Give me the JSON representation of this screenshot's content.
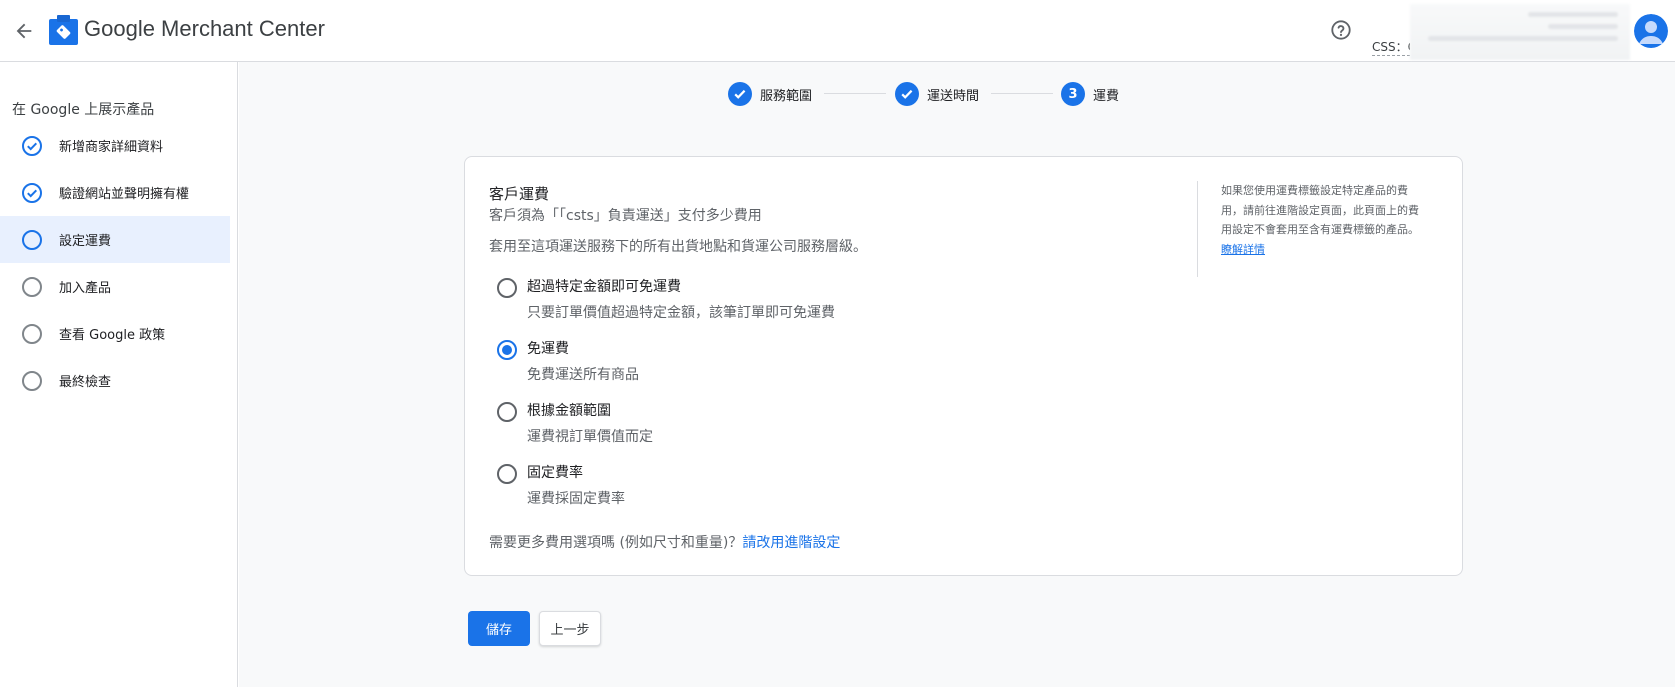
{
  "header": {
    "title": "Google Merchant Center",
    "help_icon": "help-circle-icon",
    "account_label": "CSS：C",
    "avatar_icon": "account-avatar-icon"
  },
  "sidebar": {
    "heading": "在 Google 上展示產品",
    "items": [
      {
        "label": "新增商家詳細資料",
        "status": "done",
        "active": false
      },
      {
        "label": "驗證網站並聲明擁有權",
        "status": "done",
        "active": false
      },
      {
        "label": "設定運費",
        "status": "todo",
        "active": true
      },
      {
        "label": "加入產品",
        "status": "todo",
        "active": false
      },
      {
        "label": "查看 Google 政策",
        "status": "todo",
        "active": false
      },
      {
        "label": "最終檢查",
        "status": "todo",
        "active": false
      }
    ]
  },
  "stepper": {
    "steps": [
      {
        "label": "服務範圍",
        "state": "done"
      },
      {
        "label": "運送時間",
        "state": "done"
      },
      {
        "label": "運費",
        "number": "3",
        "state": "current"
      }
    ]
  },
  "card": {
    "title": "客戶運費",
    "subtitle": "客戶須為「「csts」負責運送」支付多少費用",
    "description": "套用至這項運送服務下的所有出貨地點和貨運公司服務層級。",
    "options": [
      {
        "label": "超過特定金額即可免運費",
        "desc": "只要訂單價值超過特定金額，該筆訂單即可免運費",
        "selected": false
      },
      {
        "label": "免運費",
        "desc": "免費運送所有商品",
        "selected": true
      },
      {
        "label": "根據金額範圍",
        "desc": "運費視訂單價值而定",
        "selected": false
      },
      {
        "label": "固定費率",
        "desc": "運費採固定費率",
        "selected": false
      }
    ],
    "footer_text": "需要更多費用選項嗎 (例如尺寸和重量)？",
    "footer_link": "請改用進階設定",
    "side_note": "如果您使用運費標籤設定特定產品的費用，請前往進階設定頁面，此頁面上的費用設定不會套用至含有運費標籤的產品。",
    "side_link": "瞭解詳情"
  },
  "buttons": {
    "save": "儲存",
    "previous": "上一步"
  },
  "colors": {
    "accent": "#1a73e8",
    "active_bg": "#e8f0fe",
    "main_bg": "#f8f9fa"
  }
}
